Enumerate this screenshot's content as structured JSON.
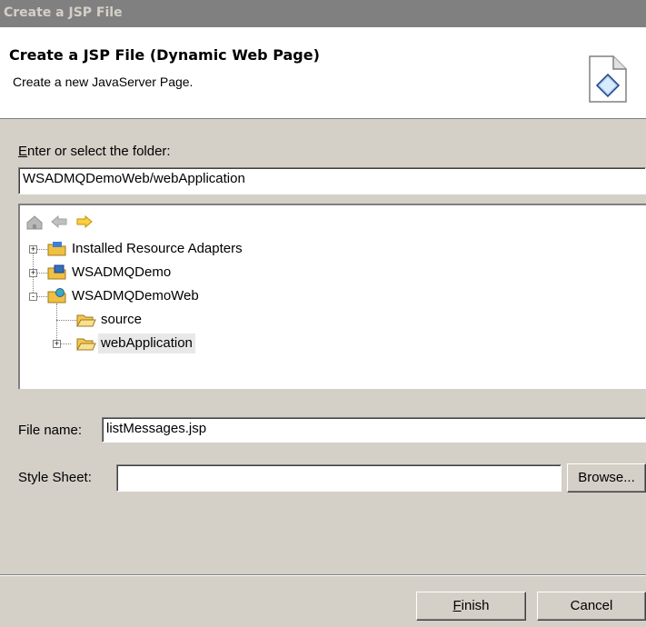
{
  "window": {
    "title": "Create a JSP File"
  },
  "banner": {
    "title": "Create a JSP File (Dynamic Web Page)",
    "description": "Create a new JavaServer Page.",
    "icon": "wizard-page-icon"
  },
  "folder": {
    "label": "Enter or select the folder:",
    "mnemonic": "E",
    "label_rest": "nter or select the folder:",
    "value": "WSADMQDemoWeb/webApplication"
  },
  "tree_toolbar": {
    "home_icon": "home-icon",
    "back_icon": "back-arrow-icon",
    "forward_icon": "forward-arrow-icon"
  },
  "tree": {
    "nodes": [
      {
        "label": "Installed Resource Adapters",
        "expander": "+",
        "icon": "project-folder-icon"
      },
      {
        "label": "WSADMQDemo",
        "expander": "+",
        "icon": "ear-project-icon"
      },
      {
        "label": "WSADMQDemoWeb",
        "expander": "-",
        "icon": "web-project-icon"
      },
      {
        "label": "source",
        "expander": "",
        "icon": "folder-icon"
      },
      {
        "label": "webApplication",
        "expander": "+",
        "icon": "folder-icon",
        "selected": true
      }
    ]
  },
  "file_name": {
    "label": "File name:",
    "value": "listMessages.jsp"
  },
  "style_sheet": {
    "label": "Style Sheet:",
    "value": "",
    "browse_label": "Browse..."
  },
  "buttons": {
    "finish": "Finish",
    "finish_mnemonic": "F",
    "finish_rest": "inish",
    "cancel": "Cancel"
  }
}
